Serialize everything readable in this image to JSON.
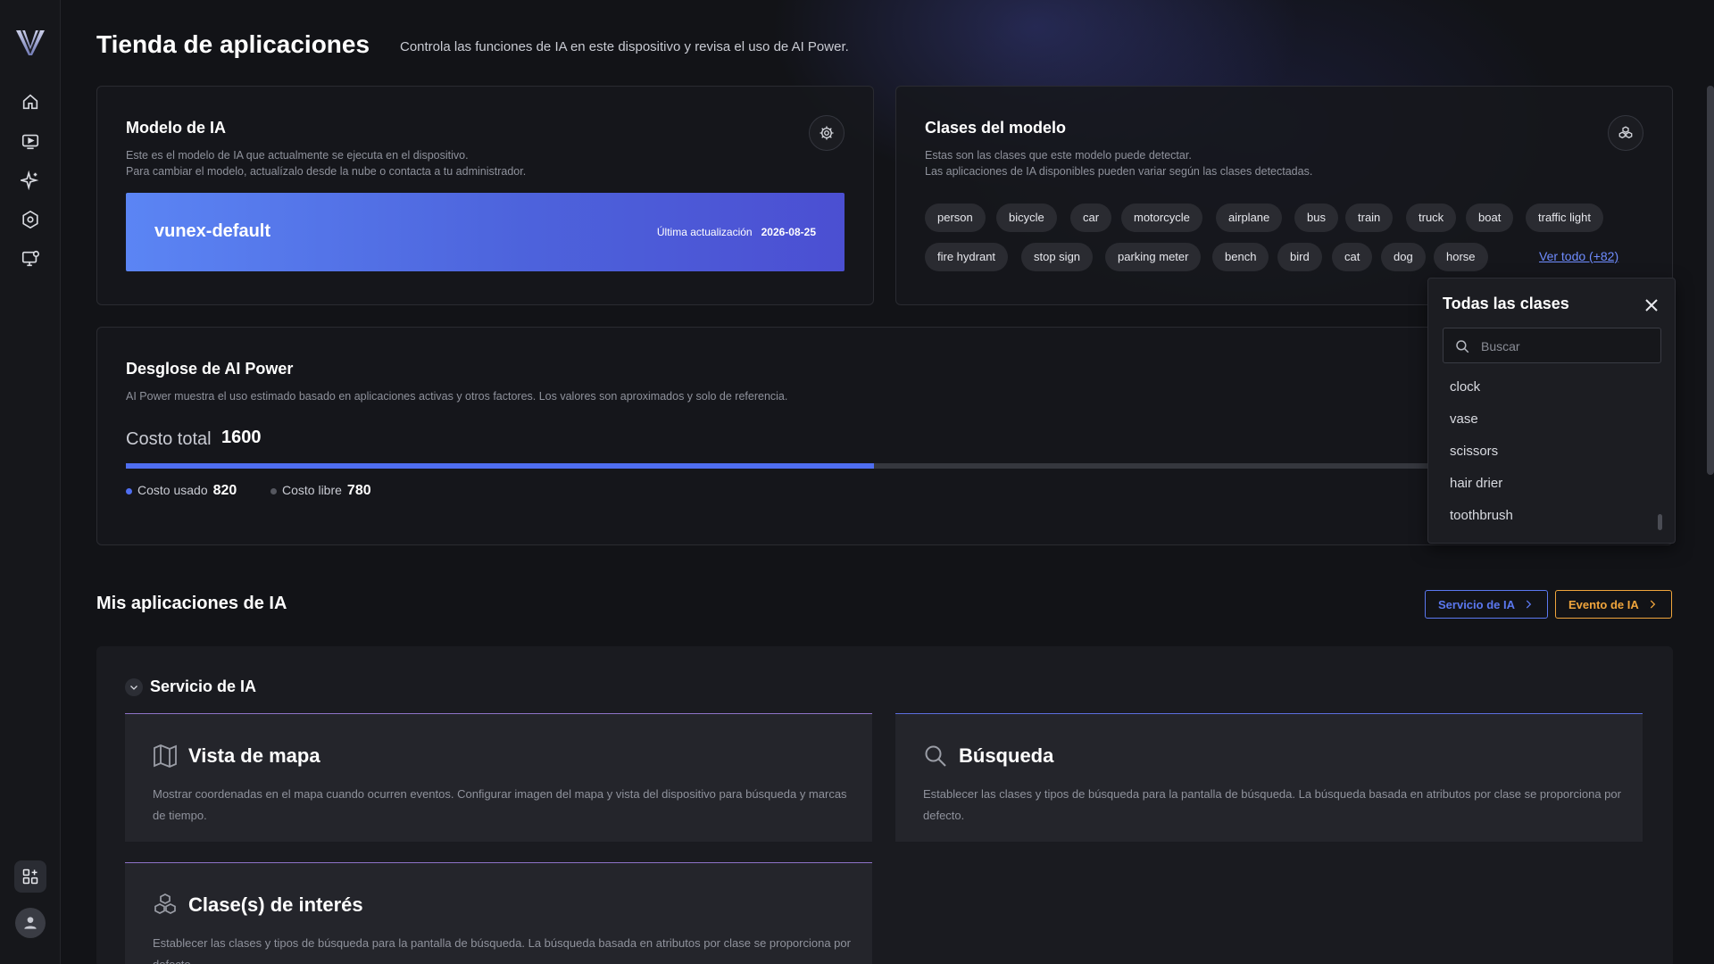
{
  "header": {
    "title": "Tienda de aplicaciones",
    "subtitle": "Controla las funciones de IA en este dispositivo y revisa el uso de AI Power."
  },
  "sidebar": {
    "items": [
      {
        "icon": "home-icon"
      },
      {
        "icon": "video-play-icon"
      },
      {
        "icon": "sparkle-icon"
      },
      {
        "icon": "settings-icon"
      },
      {
        "icon": "monitor-settings-icon"
      }
    ],
    "bottom": {
      "icon": "apps-grid-icon",
      "user_icon": "user-avatar-icon"
    }
  },
  "model_card": {
    "title": "Modelo de IA",
    "desc_line1": "Este es el modelo de IA que actualmente se ejecuta en el dispositivo.",
    "desc_line2": "Para cambiar el modelo, actualízalo desde la nube o contacta a tu administrador.",
    "model_name": "vunex-default",
    "last_update_label": "Última actualización",
    "last_update_date": "2026-08-25"
  },
  "classes_card": {
    "title": "Clases del modelo",
    "desc_line1": "Estas son las clases que este modelo puede detectar.",
    "desc_line2": "Las aplicaciones de IA disponibles pueden variar según las clases detectadas.",
    "chips": [
      "person",
      "bicycle",
      "car",
      "motorcycle",
      "airplane",
      "bus",
      "train",
      "truck",
      "boat",
      "traffic light",
      "fire hydrant",
      "stop sign",
      "parking meter",
      "bench",
      "bird",
      "cat",
      "dog",
      "horse"
    ],
    "see_all": "Ver todo (+82)"
  },
  "power_card": {
    "title": "Desglose de AI Power",
    "desc": "AI Power muestra el uso estimado basado en aplicaciones activas y otros factores. Los valores son aproximados y solo de referencia.",
    "total_label": "Costo total",
    "total_value": "1600",
    "used_label": "Costo usado",
    "used_value": "820",
    "free_label": "Costo libre",
    "free_value": "780",
    "used_fraction": 0.5125,
    "used_color": "#4f6ef0",
    "free_color": "#55575f"
  },
  "popover": {
    "title": "Todas las clases",
    "search_placeholder": "Buscar",
    "items": [
      "clock",
      "vase",
      "scissors",
      "hair drier",
      "toothbrush"
    ]
  },
  "apps_section": {
    "title": "Mis aplicaciones de IA",
    "service_button": "Servicio de IA",
    "event_button": "Evento de IA",
    "service_color": "#5b78f0",
    "event_color": "#f0a53c",
    "group_title": "Servicio de IA",
    "apps": [
      {
        "title": "Vista de mapa",
        "icon": "map-icon",
        "desc": "Mostrar coordenadas en el mapa cuando ocurren eventos. Configurar imagen del mapa y vista del dispositivo para búsqueda y marcas de tiempo."
      },
      {
        "title": "Búsqueda",
        "icon": "search-icon",
        "desc": "Establecer las clases y tipos de búsqueda para la pantalla de búsqueda. La búsqueda basada en atributos por clase se proporciona por defecto."
      },
      {
        "title": "Clase(s) de interés",
        "icon": "cubes-icon",
        "desc": "Establecer las clases y tipos de búsqueda para la pantalla de búsqueda. La búsqueda basada en atributos por clase se proporciona por defecto."
      }
    ]
  }
}
